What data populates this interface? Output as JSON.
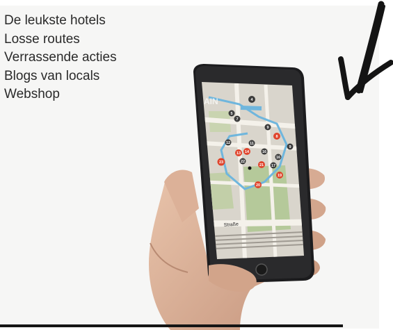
{
  "features": [
    "De leukste hotels",
    "Losse routes",
    "Verrassende acties",
    "Blogs van locals",
    "Webshop"
  ],
  "map": {
    "street_label": "Straße",
    "top_label": "AIN",
    "markers_red": [
      "6",
      "8",
      "13",
      "14",
      "21",
      "23",
      "19",
      "20"
    ],
    "markers_dark": [
      "4",
      "5",
      "7",
      "9",
      "11",
      "12",
      "16",
      "17",
      "22"
    ]
  },
  "colors": {
    "marker_red": "#e0442c",
    "marker_dark": "#3c3c3c",
    "route_blue": "#6fb6dd",
    "map_green": "#a9c28a",
    "phone_body": "#1c1c1e"
  },
  "icons": {
    "arrow": "hand-drawn-arrow-icon"
  }
}
